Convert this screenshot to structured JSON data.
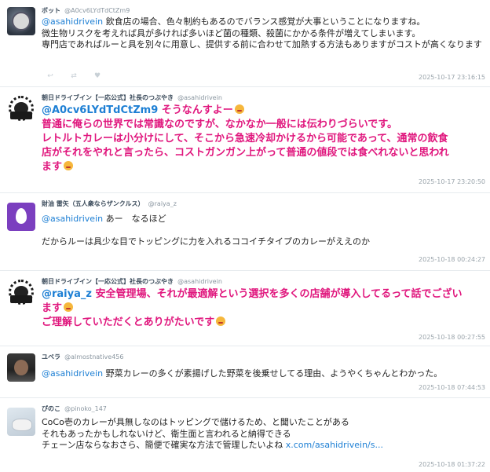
{
  "tweets": [
    {
      "name": "ボット",
      "handle": "@A0cv6LYdTdCtZm9",
      "mention": "@asahidrivein",
      "lines": [
        " 飲食店の場合、色々制約もあるのでバランス感覚が大事ということになりますね。",
        "微生物リスクを考えれば具が多ければ多いほど菌の種類、殺菌にかかる条件が増えてしまいます。",
        "専門店であればルーと具を別々に用意し、提供する前に合わせて加熱する方法もありますがコストが高くなります"
      ],
      "time": "2025-10-17 23:16:15"
    },
    {
      "name": "朝日ドライブイン【一応公式】社長のつぶやき",
      "handle": "@asahidrivein",
      "mention": "@A0cv6LYdTdCtZm9",
      "lines": [
        " そうなんすよー",
        "普通に俺らの世界では常識なのですが、なかなか一般には伝わりづらいです。",
        "レトルトカレーは小分けにして、そこから急速冷却かけるから可能であって、通常の飲食",
        "店がそれをやれと言ったら、コストガンガン上がって普通の値段では食べれないと思われ",
        "ます"
      ],
      "time": "2025-10-17 23:20:50"
    },
    {
      "name": "財油 雷矢（五人衆ならザンクルス）",
      "handle": "@raiya_z",
      "mention": "@asahidrivein",
      "lines": [
        " あー　なるほど",
        "",
        "だからルーは具少な目でトッピングに力を入れるココイチタイプのカレーがええのか"
      ],
      "time": "2025-10-18 00:24:27"
    },
    {
      "name": "朝日ドライブイン【一応公式】社長のつぶやき",
      "handle": "@asahidrivein",
      "mention": "@raiya_z",
      "lines": [
        " 安全管理場、それが最適解という選択を多くの店舗が導入してるって話でござい",
        "ます",
        "ご理解していただくとありがたいです"
      ],
      "time": "2025-10-18 00:27:55"
    },
    {
      "name": "ユベラ",
      "handle": "@almostnative456",
      "mention": "@asahidrivein",
      "lines": [
        " 野菜カレーの多くが素揚げした野菜を後乗せしてる理由、ようやくちゃんとわかった。"
      ],
      "time": "2025-10-18 07:44:53"
    },
    {
      "name": "ぴのこ",
      "handle": "@pinoko_147",
      "lines": [
        "CoCo壱のカレーが具無しなのはトッピングで儲けるため、と聞いたことがある",
        "それもあったかもしれないけど、衛生面と言われると納得できる",
        "チェーン店ならなおさら、簡便で確実な方法で管理したいよね "
      ],
      "link": "x.com/asahidrivein/s...",
      "time": "2025-10-18 01:37:22"
    }
  ],
  "icons": {
    "reply": "reply-icon",
    "retweet": "retweet-icon",
    "like": "heart-icon"
  },
  "colors": {
    "mention": "#1d7fd4",
    "highlight": "#e0167d",
    "timestamp": "#9aa4ab"
  }
}
